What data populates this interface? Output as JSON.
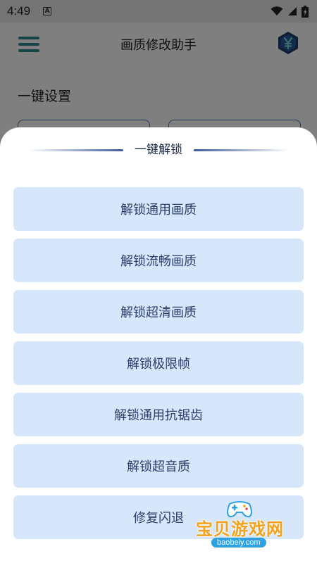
{
  "status_bar": {
    "time": "4:49",
    "notification_icon": "A"
  },
  "app_bar": {
    "title": "画质修改助手",
    "menu_icon": "hamburger-menu-icon",
    "right_icon": "yen-hexagon-icon"
  },
  "background": {
    "section_title": "一键设置"
  },
  "sheet": {
    "title": "一键解锁",
    "options": [
      {
        "label": "解锁通用画质"
      },
      {
        "label": "解锁流畅画质"
      },
      {
        "label": "解锁超清画质"
      },
      {
        "label": "解锁极限帧"
      },
      {
        "label": "解锁通用抗锯齿"
      },
      {
        "label": "解锁超音质"
      },
      {
        "label": "修复闪退"
      }
    ]
  },
  "watermark": {
    "brand": "宝贝游戏网",
    "url": "baobeiy.com"
  },
  "colors": {
    "option_bg": "#d6e6fb",
    "option_text": "#2c3e6b",
    "accent": "#3d5a9c",
    "menu_teal": "#2a8a8a",
    "watermark_orange": "#f3a21b"
  }
}
